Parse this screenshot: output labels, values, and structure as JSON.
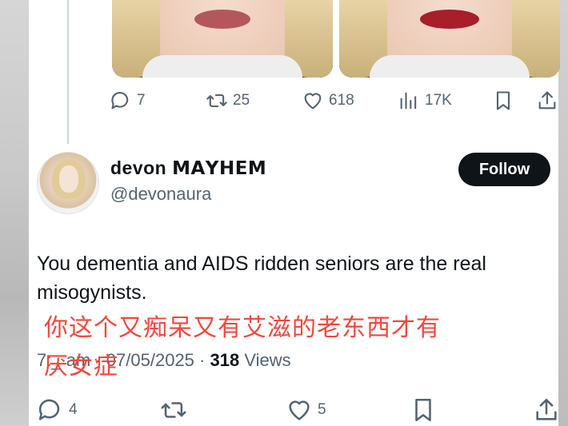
{
  "previous_tweet": {
    "actions": {
      "reply_count": "7",
      "retweet_count": "25",
      "like_count": "618",
      "view_count": "17K"
    }
  },
  "tweet": {
    "display_name": "devon 𝗠𝗔𝗬𝗛𝗘𝗠",
    "handle": "@devonaura",
    "follow_label": "Follow",
    "text": "You dementia and AIDS ridden seniors are the real misogynists.",
    "timestamp": "7:_ am · 07/05/2025",
    "views_count": "318",
    "views_label": "Views",
    "actions": {
      "reply_count": "4",
      "like_count": "5"
    }
  },
  "caption": {
    "line1": "你这个又痴呆又有艾滋的老东西才有",
    "line2": "厌女症"
  },
  "colors": {
    "caption": "#f0483e",
    "secondary_text": "#536471",
    "follow_bg": "#0f1419"
  }
}
